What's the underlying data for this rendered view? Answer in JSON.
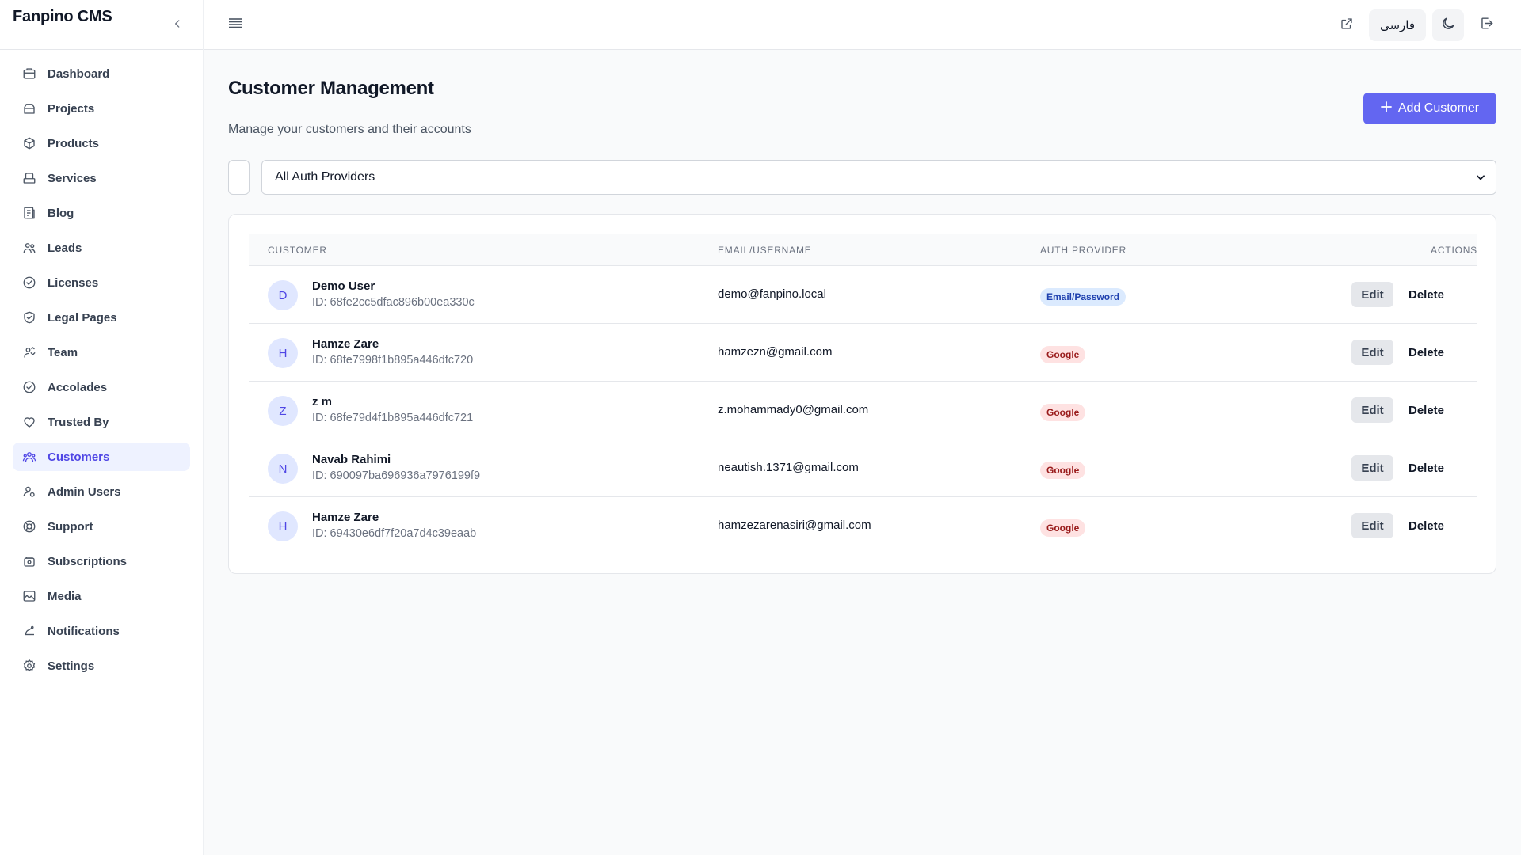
{
  "app": {
    "title": "Fanpino CMS"
  },
  "sidebar": {
    "items": [
      {
        "label": "Dashboard",
        "icon": "dashboard-icon"
      },
      {
        "label": "Projects",
        "icon": "projects-icon"
      },
      {
        "label": "Products",
        "icon": "products-icon"
      },
      {
        "label": "Services",
        "icon": "services-icon"
      },
      {
        "label": "Blog",
        "icon": "blog-icon"
      },
      {
        "label": "Leads",
        "icon": "leads-icon"
      },
      {
        "label": "Licenses",
        "icon": "licenses-icon"
      },
      {
        "label": "Legal Pages",
        "icon": "legal-icon"
      },
      {
        "label": "Team",
        "icon": "team-icon"
      },
      {
        "label": "Accolades",
        "icon": "accolades-icon"
      },
      {
        "label": "Trusted By",
        "icon": "heart-icon"
      },
      {
        "label": "Customers",
        "icon": "customers-icon",
        "active": true
      },
      {
        "label": "Admin Users",
        "icon": "admin-users-icon"
      },
      {
        "label": "Support",
        "icon": "support-icon"
      },
      {
        "label": "Subscriptions",
        "icon": "subscriptions-icon"
      },
      {
        "label": "Media",
        "icon": "media-icon"
      },
      {
        "label": "Notifications",
        "icon": "notifications-icon"
      },
      {
        "label": "Settings",
        "icon": "settings-icon"
      }
    ]
  },
  "topbar": {
    "language_label": "فارسی"
  },
  "page": {
    "title": "Customer Management",
    "subtitle": "Manage your customers and their accounts",
    "add_button_label": "Add Customer",
    "provider_filter": "All Auth Providers"
  },
  "table": {
    "headers": [
      "CUSTOMER",
      "EMAIL/USERNAME",
      "AUTH PROVIDER",
      "ACTIONS"
    ],
    "edit_label": "Edit",
    "delete_label": "Delete",
    "rows": [
      {
        "initial": "D",
        "name": "Demo User",
        "id": "ID: 68fe2cc5dfac896b00ea330c",
        "email": "demo@fanpino.local",
        "provider": "Email/Password"
      },
      {
        "initial": "H",
        "name": "Hamze Zare",
        "id": "ID: 68fe7998f1b895a446dfc720",
        "email": "hamzezn@gmail.com",
        "provider": "Google"
      },
      {
        "initial": "Z",
        "name": "z m",
        "id": "ID: 68fe79d4f1b895a446dfc721",
        "email": "z.mohammady0@gmail.com",
        "provider": "Google"
      },
      {
        "initial": "N",
        "name": "Navab Rahimi",
        "id": "ID: 690097ba696936a7976199f9",
        "email": "neautish.1371@gmail.com",
        "provider": "Google"
      },
      {
        "initial": "H",
        "name": "Hamze Zare",
        "id": "ID: 69430e6df7f20a7d4c39eaab",
        "email": "hamzezarenasiri@gmail.com",
        "provider": "Google"
      }
    ]
  },
  "colors": {
    "accent": "#6366f1",
    "active_bg": "#eef2ff",
    "email_badge_bg": "#dbeafe",
    "google_badge_bg": "#fee2e2"
  }
}
